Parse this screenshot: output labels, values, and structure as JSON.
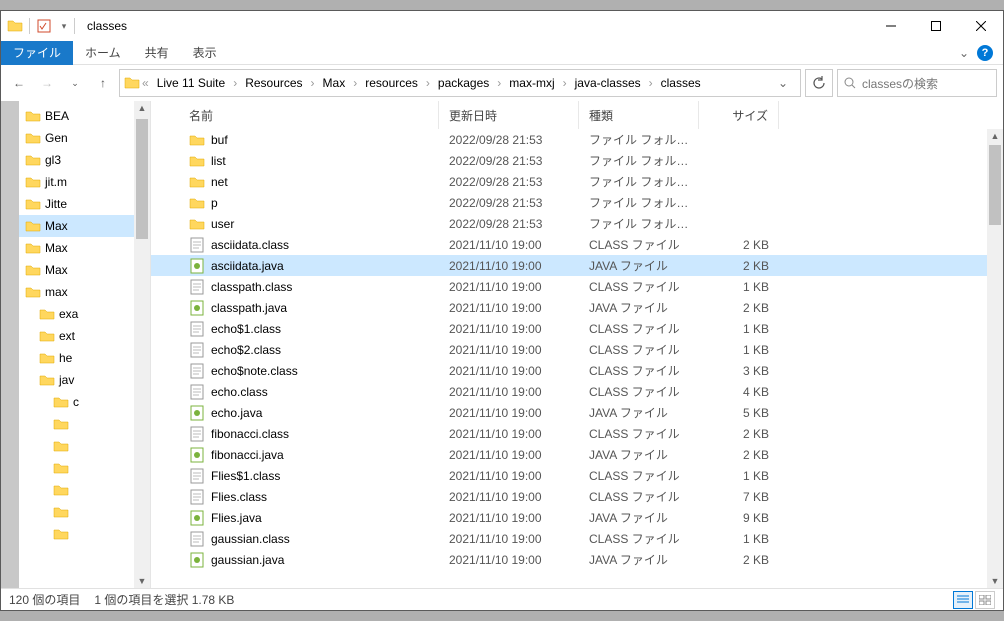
{
  "title": "classes",
  "ribbon": {
    "file": "ファイル",
    "home": "ホーム",
    "share": "共有",
    "view": "表示"
  },
  "breadcrumb": [
    "Live 11 Suite",
    "Resources",
    "Max",
    "resources",
    "packages",
    "max-mxj",
    "java-classes",
    "classes"
  ],
  "searchPlaceholder": "classesの検索",
  "columns": {
    "name": "名前",
    "date": "更新日時",
    "type": "種類",
    "size": "サイズ"
  },
  "tree": [
    {
      "label": "BEA",
      "indent": 0
    },
    {
      "label": "Gen",
      "indent": 0
    },
    {
      "label": "gl3",
      "indent": 0
    },
    {
      "label": "jit.m",
      "indent": 0
    },
    {
      "label": "Jitte",
      "indent": 0
    },
    {
      "label": "Max",
      "indent": 0,
      "selected": true
    },
    {
      "label": "Max",
      "indent": 0
    },
    {
      "label": "Max",
      "indent": 0
    },
    {
      "label": "max",
      "indent": 0
    },
    {
      "label": "exa",
      "indent": 1
    },
    {
      "label": "ext",
      "indent": 1
    },
    {
      "label": "he",
      "indent": 1
    },
    {
      "label": "jav",
      "indent": 1
    },
    {
      "label": "c",
      "indent": 2
    },
    {
      "label": "",
      "indent": 2
    },
    {
      "label": "",
      "indent": 2
    },
    {
      "label": "",
      "indent": 2
    },
    {
      "label": "",
      "indent": 2
    },
    {
      "label": "",
      "indent": 2
    },
    {
      "label": "",
      "indent": 2
    }
  ],
  "rows": [
    {
      "icon": "folder",
      "name": "buf",
      "date": "2022/09/28 21:53",
      "type": "ファイル フォルダー",
      "size": ""
    },
    {
      "icon": "folder",
      "name": "list",
      "date": "2022/09/28 21:53",
      "type": "ファイル フォルダー",
      "size": ""
    },
    {
      "icon": "folder",
      "name": "net",
      "date": "2022/09/28 21:53",
      "type": "ファイル フォルダー",
      "size": ""
    },
    {
      "icon": "folder",
      "name": "p",
      "date": "2022/09/28 21:53",
      "type": "ファイル フォルダー",
      "size": ""
    },
    {
      "icon": "folder",
      "name": "user",
      "date": "2022/09/28 21:53",
      "type": "ファイル フォルダー",
      "size": ""
    },
    {
      "icon": "class",
      "name": "asciidata.class",
      "date": "2021/11/10 19:00",
      "type": "CLASS ファイル",
      "size": "2 KB"
    },
    {
      "icon": "java",
      "name": "asciidata.java",
      "date": "2021/11/10 19:00",
      "type": "JAVA ファイル",
      "size": "2 KB",
      "selected": true
    },
    {
      "icon": "class",
      "name": "classpath.class",
      "date": "2021/11/10 19:00",
      "type": "CLASS ファイル",
      "size": "1 KB"
    },
    {
      "icon": "java",
      "name": "classpath.java",
      "date": "2021/11/10 19:00",
      "type": "JAVA ファイル",
      "size": "2 KB"
    },
    {
      "icon": "class",
      "name": "echo$1.class",
      "date": "2021/11/10 19:00",
      "type": "CLASS ファイル",
      "size": "1 KB"
    },
    {
      "icon": "class",
      "name": "echo$2.class",
      "date": "2021/11/10 19:00",
      "type": "CLASS ファイル",
      "size": "1 KB"
    },
    {
      "icon": "class",
      "name": "echo$note.class",
      "date": "2021/11/10 19:00",
      "type": "CLASS ファイル",
      "size": "3 KB"
    },
    {
      "icon": "class",
      "name": "echo.class",
      "date": "2021/11/10 19:00",
      "type": "CLASS ファイル",
      "size": "4 KB"
    },
    {
      "icon": "java",
      "name": "echo.java",
      "date": "2021/11/10 19:00",
      "type": "JAVA ファイル",
      "size": "5 KB"
    },
    {
      "icon": "class",
      "name": "fibonacci.class",
      "date": "2021/11/10 19:00",
      "type": "CLASS ファイル",
      "size": "2 KB"
    },
    {
      "icon": "java",
      "name": "fibonacci.java",
      "date": "2021/11/10 19:00",
      "type": "JAVA ファイル",
      "size": "2 KB"
    },
    {
      "icon": "class",
      "name": "Flies$1.class",
      "date": "2021/11/10 19:00",
      "type": "CLASS ファイル",
      "size": "1 KB"
    },
    {
      "icon": "class",
      "name": "Flies.class",
      "date": "2021/11/10 19:00",
      "type": "CLASS ファイル",
      "size": "7 KB"
    },
    {
      "icon": "java",
      "name": "Flies.java",
      "date": "2021/11/10 19:00",
      "type": "JAVA ファイル",
      "size": "9 KB"
    },
    {
      "icon": "class",
      "name": "gaussian.class",
      "date": "2021/11/10 19:00",
      "type": "CLASS ファイル",
      "size": "1 KB"
    },
    {
      "icon": "java",
      "name": "gaussian.java",
      "date": "2021/11/10 19:00",
      "type": "JAVA ファイル",
      "size": "2 KB"
    }
  ],
  "status": {
    "items": "120 個の項目",
    "selected": "1 個の項目を選択 1.78 KB"
  }
}
